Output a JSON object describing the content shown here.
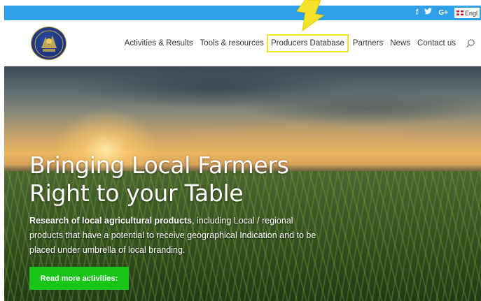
{
  "topbar": {
    "social": [
      "f",
      "𝐲",
      "G+"
    ],
    "social_icons": [
      "facebook-icon",
      "twitter-icon",
      "google-plus-icon"
    ],
    "language": "Engl"
  },
  "nav": {
    "items": [
      {
        "label": "Activities & Results",
        "name": "nav-activities-results"
      },
      {
        "label": "Tools & resources",
        "name": "nav-tools-resources"
      },
      {
        "label": "Producers Database",
        "name": "nav-producers-database"
      },
      {
        "label": "Partners",
        "name": "nav-partners"
      },
      {
        "label": "News",
        "name": "nav-news"
      },
      {
        "label": "Contact us",
        "name": "nav-contact-us"
      }
    ]
  },
  "hero": {
    "title_line1": "Bringing Local Farmers",
    "title_line2": "Right to your Table",
    "desc_bold": "Research of local agricultural products",
    "desc_rest": ", including Local / regional products that have a potential to receive geographical Indication and to be placed under umbrella of local branding.",
    "cta_label": "Read more activities:"
  },
  "colors": {
    "topbar": "#2f9fe8",
    "cta": "#1ac51a",
    "highlight": "#f2e12c",
    "nav_text": "#333333"
  }
}
